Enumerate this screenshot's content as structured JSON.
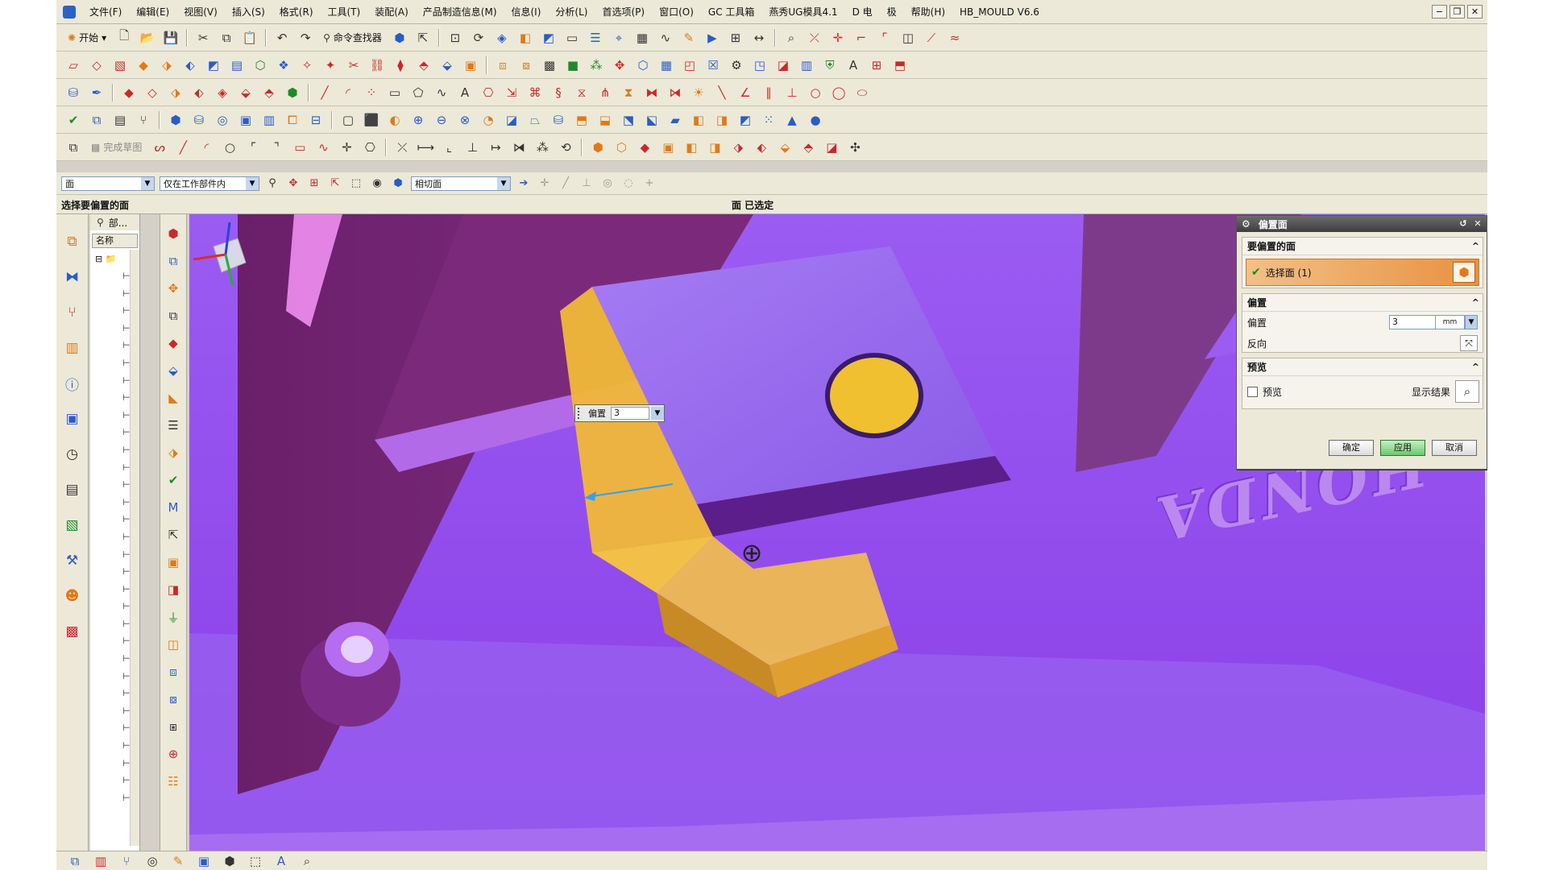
{
  "menu": {
    "items": [
      "文件(F)",
      "编辑(E)",
      "视图(V)",
      "插入(S)",
      "格式(R)",
      "工具(T)",
      "装配(A)",
      "产品制造信息(M)",
      "信息(I)",
      "分析(L)",
      "首选项(P)",
      "窗口(O)",
      "GC 工具箱",
      "燕秀UG模具4.1",
      "D 电",
      "极",
      "帮助(H)",
      "HB_MOULD V6.6"
    ]
  },
  "toolbar": {
    "start_label": "开始",
    "command_finder_label": "命令查找器",
    "sketch_label": "完成草图"
  },
  "filter": {
    "type_value": "面",
    "scope_value": "仅在工作部件内",
    "rule_value": "相切面"
  },
  "cue": {
    "prompt": "选择要偏置的面",
    "status": "面 已选定"
  },
  "navigator": {
    "tab_label": "部...",
    "column_name": "名称"
  },
  "viewport": {
    "brand_text": "HONDA",
    "onscreen_label": "偏置",
    "onscreen_value": "3"
  },
  "dialog": {
    "title": "偏置面",
    "face_group_title": "要偏置的面",
    "select_face_label": "选择面 (1)",
    "offset_group_title": "偏置",
    "offset_label": "偏置",
    "offset_value": "3",
    "offset_unit": "mm",
    "reverse_label": "反向",
    "preview_group_title": "预览",
    "preview_label": "预览",
    "show_result_label": "显示结果",
    "ok_label": "确定",
    "apply_label": "应用",
    "cancel_label": "取消"
  },
  "icons": {
    "toolbar_row1": [
      "new-icon",
      "open-icon",
      "save-icon",
      "cut-icon",
      "copy-icon",
      "paste-icon",
      "undo-icon",
      "redo-icon"
    ],
    "dialog": [
      "gear-icon",
      "reset-icon",
      "close-icon",
      "chevron-up-icon",
      "face-select-icon",
      "reverse-icon",
      "magnifier-icon"
    ]
  },
  "colors": {
    "viewport_bg": "#8a3ee8",
    "highlight_face": "#f0b838",
    "selected_row": "#e89240",
    "apply_button": "#6cc86c"
  }
}
